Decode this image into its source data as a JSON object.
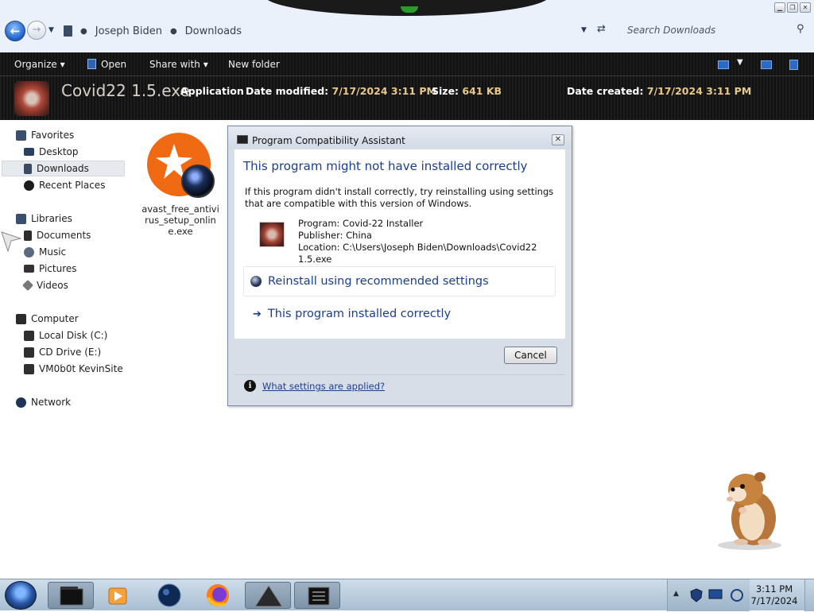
{
  "window": {
    "controls": [
      "minimize",
      "restore",
      "close"
    ]
  },
  "address_bar": {
    "breadcrumb": [
      "Joseph Biden",
      "Downloads"
    ],
    "search_placeholder": "Search Downloads"
  },
  "command_bar": {
    "organize": "Organize",
    "open": "Open",
    "share_with": "Share with",
    "new_folder": "New folder"
  },
  "details_pane": {
    "file_name": "Covid22 1.5.exe",
    "file_type": "Application",
    "date_modified_label": "Date modified:",
    "date_modified_value": "7/17/2024 3:11 PM",
    "size_label": "Size:",
    "size_value": "641 KB",
    "date_created_label": "Date created:",
    "date_created_value": "7/17/2024 3:11 PM"
  },
  "nav_pane": {
    "favorites": "Favorites",
    "desktop": "Desktop",
    "downloads": "Downloads",
    "recent_places": "Recent Places",
    "libraries": "Libraries",
    "documents": "Documents",
    "music": "Music",
    "pictures": "Pictures",
    "videos": "Videos",
    "computer": "Computer",
    "local_disk": "Local Disk (C:)",
    "cd_drive": "CD Drive (E:)",
    "network_share": "VM0b0t KevinSite",
    "network": "Network"
  },
  "files": [
    {
      "name": "avast_free_antivirus_setup_online.exe",
      "icon": "avast-installer-icon"
    }
  ],
  "dialog": {
    "title": "Program Compatibility Assistant",
    "heading": "This program might not have installed correctly",
    "description": "If this program didn't install correctly, try reinstalling using settings that are compatible with this version of Windows.",
    "program": "Program: Covid-22 Installer",
    "publisher": "Publisher: China",
    "location": "Location: C:\\Users\\Joseph Biden\\Downloads\\Covid22 1.5.exe",
    "option_reinstall": "Reinstall using recommended settings",
    "option_correct": "This program installed correctly",
    "cancel": "Cancel",
    "help_link": "What settings are applied?"
  },
  "taskbar": {
    "pinned": [
      "explorer-icon",
      "media-player-icon",
      "globe-icon",
      "firefox-icon",
      "warning-app-icon",
      "notes-app-icon"
    ],
    "active_index": 0,
    "clock_time": "3:11 PM",
    "clock_date": "7/17/2024"
  }
}
